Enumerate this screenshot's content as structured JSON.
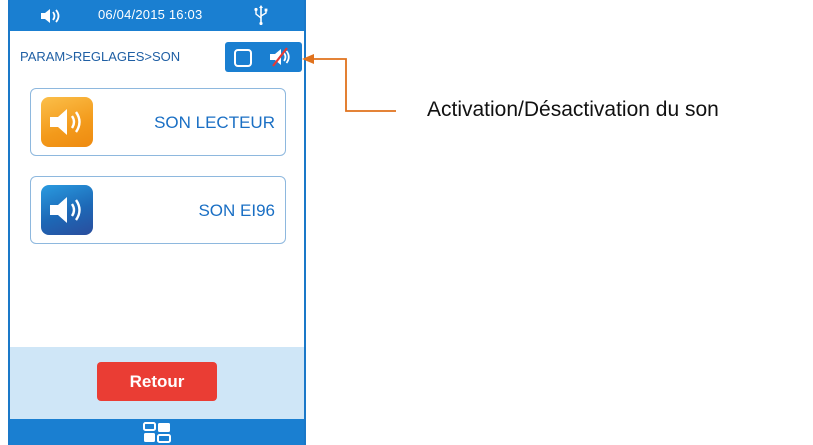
{
  "status_bar": {
    "datetime": "06/04/2015 16:03",
    "left_icon": "speaker-icon",
    "right_icon": "usb-icon"
  },
  "breadcrumb": "PARAM>REGLAGES>SON",
  "sound_toggle": {
    "checkbox_checked": false,
    "icon": "muted-speaker-icon"
  },
  "menu": {
    "items": [
      {
        "label": "SON LECTEUR",
        "icon": "speaker-icon",
        "tile_color": "#f39a1b"
      },
      {
        "label": "SON EI96",
        "icon": "speaker-icon",
        "tile_color": "#1d68b6"
      }
    ]
  },
  "footer": {
    "back_label": "Retour",
    "apps_icon": "apps-grid-icon"
  },
  "annotation": {
    "text": "Activation/Désactivation du son",
    "color": "#e0721d"
  },
  "colors": {
    "primary": "#1a7fd1",
    "panel": "#cfe6f7",
    "danger": "#ea3d34",
    "text_blue": "#1a6fc4"
  }
}
